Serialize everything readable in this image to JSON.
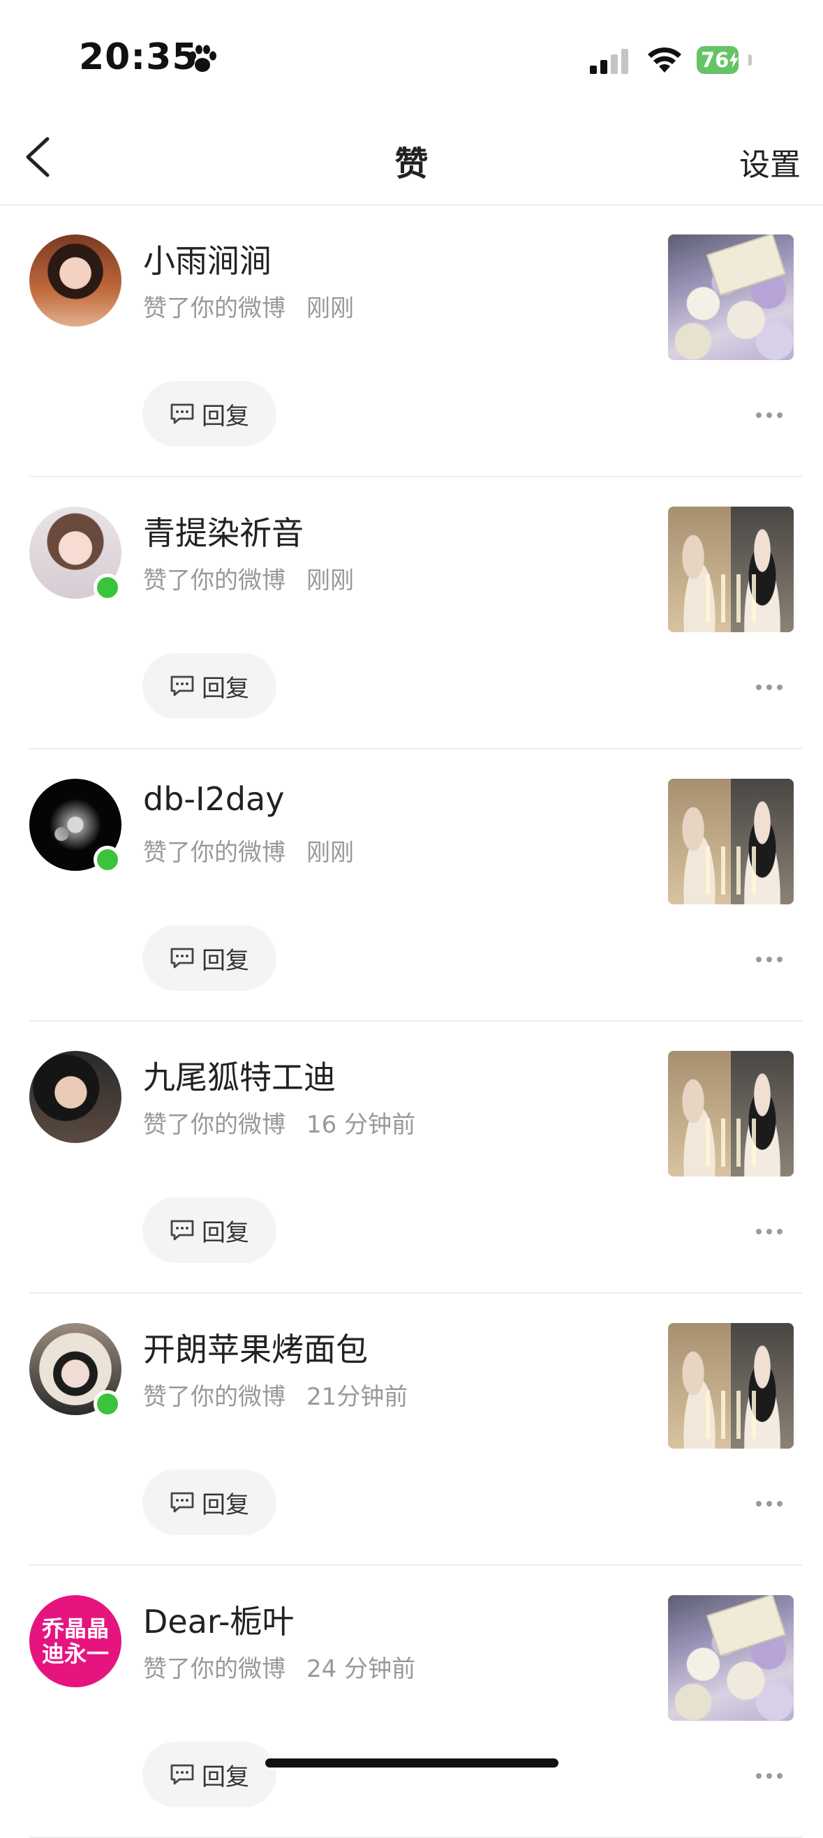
{
  "status_bar": {
    "time": "20:35",
    "battery": "76"
  },
  "nav": {
    "title": "赞",
    "settings": "设置"
  },
  "reply_label": "回复",
  "items": [
    {
      "name": "小雨涧涧",
      "action": "赞了你的微博",
      "time": "刚刚",
      "online": false,
      "thumb": "flowers"
    },
    {
      "name": "青提染祈音",
      "action": "赞了你的微博",
      "time": "刚刚",
      "online": true,
      "thumb": "duo"
    },
    {
      "name": "db-I2day",
      "action": "赞了你的微博",
      "time": "刚刚",
      "online": true,
      "thumb": "duo"
    },
    {
      "name": "九尾狐特工迪",
      "action": "赞了你的微博",
      "time": "16 分钟前",
      "online": false,
      "thumb": "duo"
    },
    {
      "name": "开朗苹果烤面包",
      "action": "赞了你的微博",
      "time": "21分钟前",
      "online": true,
      "thumb": "duo"
    },
    {
      "name": "Dear-栀叶",
      "action": "赞了你的微博",
      "time": "24 分钟前",
      "online": false,
      "thumb": "flowers",
      "avatar_text": [
        "乔晶晶",
        "迪永一"
      ]
    }
  ]
}
